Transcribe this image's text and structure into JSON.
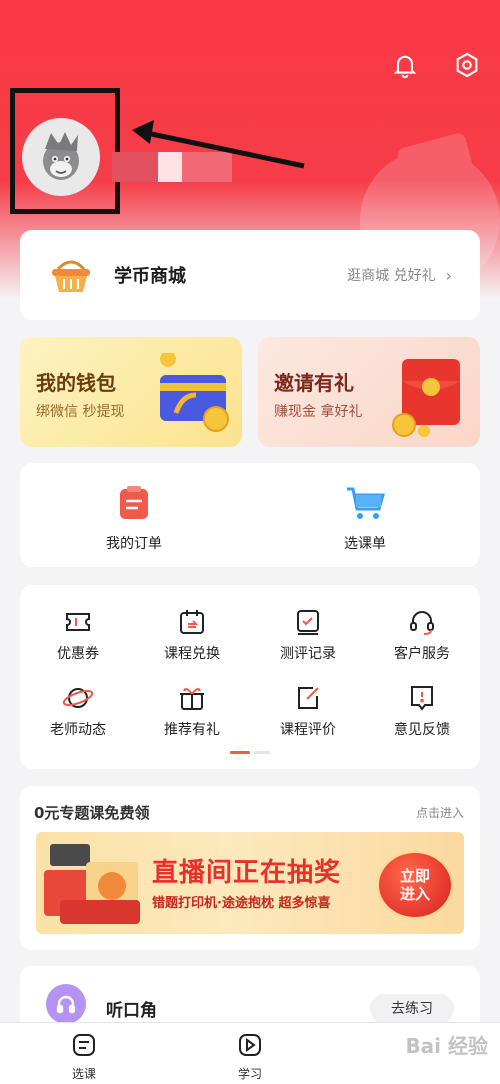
{
  "header": {
    "notification_icon": "bell-icon",
    "settings_icon": "gear-icon"
  },
  "mall": {
    "title": "学币商城",
    "link": "逛商城 兑好礼",
    "chevron": "›"
  },
  "wallet": {
    "title": "我的钱包",
    "subtitle": "绑微信 秒提现"
  },
  "invite": {
    "title": "邀请有礼",
    "subtitle": "赚现金 拿好礼"
  },
  "orders": {
    "items": [
      {
        "label": "我的订单",
        "icon": "order-icon"
      },
      {
        "label": "选课单",
        "icon": "cart-icon"
      }
    ]
  },
  "services": {
    "items": [
      {
        "label": "优惠券",
        "icon": "coupon-icon"
      },
      {
        "label": "课程兑换",
        "icon": "calendar-exchange-icon"
      },
      {
        "label": "测评记录",
        "icon": "assessment-icon"
      },
      {
        "label": "客户服务",
        "icon": "headset-icon"
      },
      {
        "label": "老师动态",
        "icon": "planet-icon"
      },
      {
        "label": "推荐有礼",
        "icon": "gift-icon"
      },
      {
        "label": "课程评价",
        "icon": "edit-icon"
      },
      {
        "label": "意见反馈",
        "icon": "feedback-icon"
      }
    ]
  },
  "free_course": {
    "title": "0元专题课免费领",
    "link": "点击进入",
    "banner_title": "直播间正在抽奖",
    "banner_subtitle": "错题打印机·途途抱枕 超多惊喜",
    "banner_button": "立即\n进入"
  },
  "listen": {
    "title": "听口角",
    "button": "去练习"
  },
  "tabbar": {
    "tabs": [
      {
        "label": "选课",
        "icon": "course-select-icon"
      },
      {
        "label": "学习",
        "icon": "play-icon"
      }
    ]
  },
  "watermark": "Bai 经验",
  "colors": {
    "primary": "#f53c48",
    "accent_red": "#e6322b"
  }
}
